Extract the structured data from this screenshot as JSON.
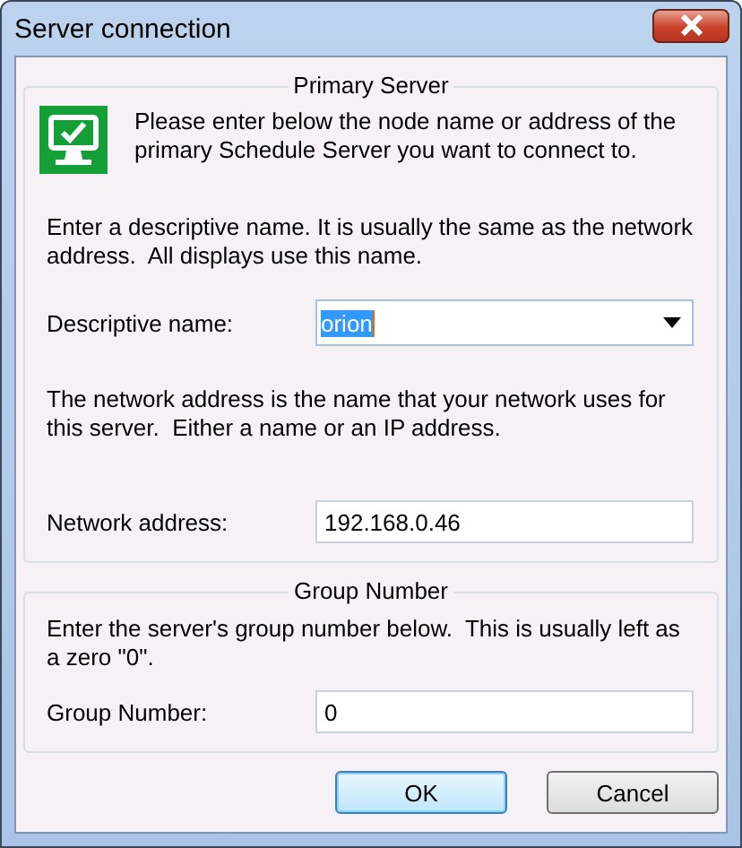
{
  "window": {
    "title": "Server connection"
  },
  "groups": [
    {
      "title": "Primary Server",
      "intro": "Please enter below the node name or address of the primary Schedule Server you want to connect to.",
      "items": [
        {
          "kind": "text",
          "text": "Enter a descriptive name. It is usually the same as the network address.  All displays use this name."
        },
        {
          "kind": "combo",
          "label": "Descriptive name:",
          "value": "orion",
          "text_selected": true
        },
        {
          "kind": "text",
          "text": "The network address is the name that your network uses for this server.  Either a name or an IP address."
        },
        {
          "kind": "field",
          "label": "Network address:",
          "value": "192.168.0.46"
        }
      ]
    },
    {
      "title": "Group Number",
      "items": [
        {
          "kind": "text",
          "text": "Enter the server's group number below.  This is usually left as a zero \"0\"."
        },
        {
          "kind": "field",
          "label": "Group Number:",
          "value": "0"
        }
      ]
    }
  ],
  "buttons": [
    {
      "label": "OK",
      "default": true
    },
    {
      "label": "Cancel",
      "default": false
    }
  ]
}
